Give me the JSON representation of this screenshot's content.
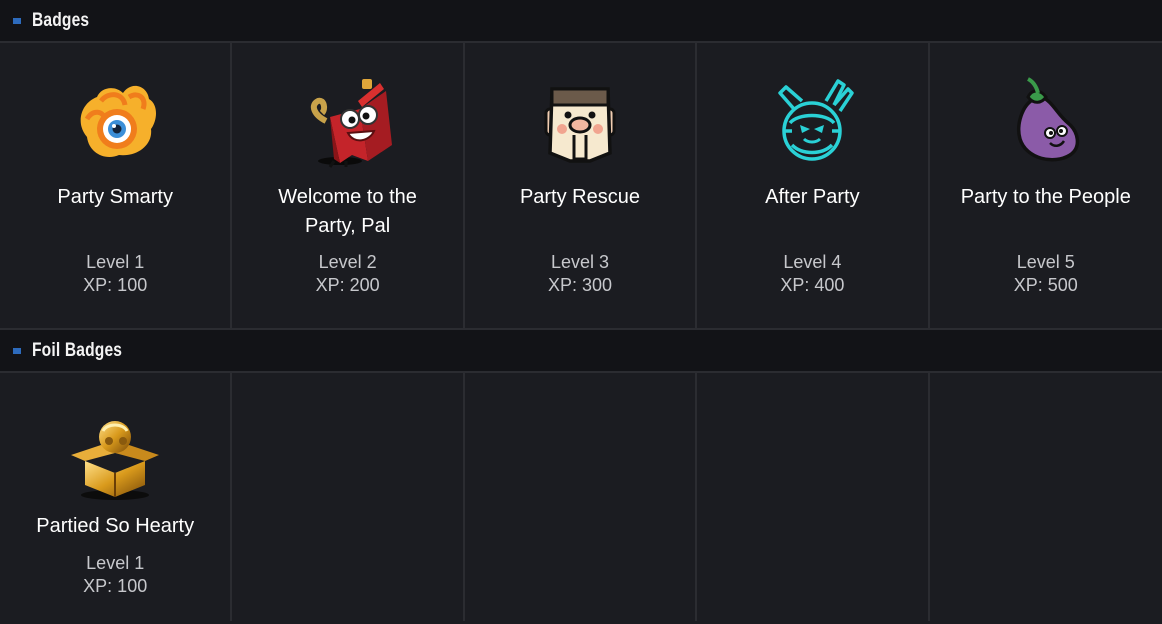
{
  "sections": {
    "badges": {
      "title": "Badges",
      "items": [
        {
          "name": "Party Smarty",
          "level": "Level 1",
          "xp": "XP: 100",
          "icon": "eye-flower-icon"
        },
        {
          "name": "Welcome to the Party, Pal",
          "level": "Level 2",
          "xp": "XP: 200",
          "icon": "firecracker-mascot-icon"
        },
        {
          "name": "Party Rescue",
          "level": "Level 3",
          "xp": "XP: 300",
          "icon": "box-face-icon"
        },
        {
          "name": "After Party",
          "level": "Level 4",
          "xp": "XP: 400",
          "icon": "neon-robot-icon"
        },
        {
          "name": "Party to the People",
          "level": "Level 5",
          "xp": "XP: 500",
          "icon": "eggplant-icon"
        }
      ]
    },
    "foil_badges": {
      "title": "Foil Badges",
      "items": [
        {
          "name": "Partied So Hearty",
          "level": "Level 1",
          "xp": "XP: 100",
          "icon": "golden-gift-box-icon"
        }
      ]
    }
  },
  "colors": {
    "accent": "#2d6bbd",
    "background": "#1b1c21",
    "header_bg": "#121317",
    "divider": "#2b2c31"
  }
}
